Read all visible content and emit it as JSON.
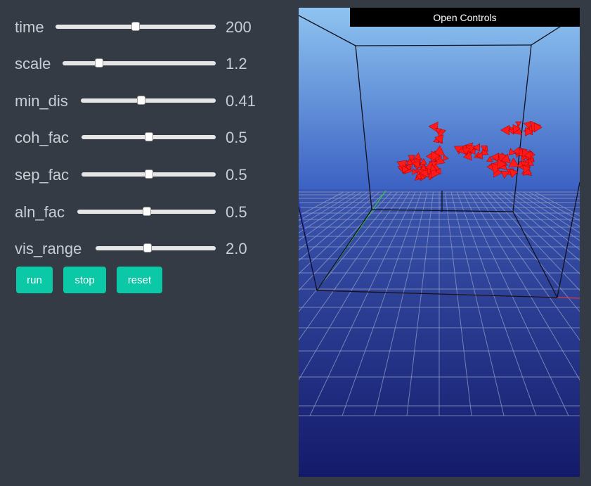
{
  "sliders": [
    {
      "label": "time",
      "value": "200",
      "level": 0.5
    },
    {
      "label": "scale",
      "value": "1.2",
      "level": 0.24
    },
    {
      "label": "min_dis",
      "value": "0.41",
      "level": 0.45
    },
    {
      "label": "coh_fac",
      "value": "0.5",
      "level": 0.5
    },
    {
      "label": "sep_fac",
      "value": "0.5",
      "level": 0.5
    },
    {
      "label": "aln_fac",
      "value": "0.5",
      "level": 0.5
    },
    {
      "label": "vis_range",
      "value": "2.0",
      "level": 0.43
    }
  ],
  "buttons": {
    "run": "run",
    "stop": "stop",
    "reset": "reset"
  },
  "viewport": {
    "open_controls_label": "Open Controls",
    "sky_top": "#8ec4f0",
    "sky_bottom": "#3a60c2",
    "ground_far": "#3b57b0",
    "ground_near": "#141a6a",
    "boid_color": "#ff1a1a"
  }
}
